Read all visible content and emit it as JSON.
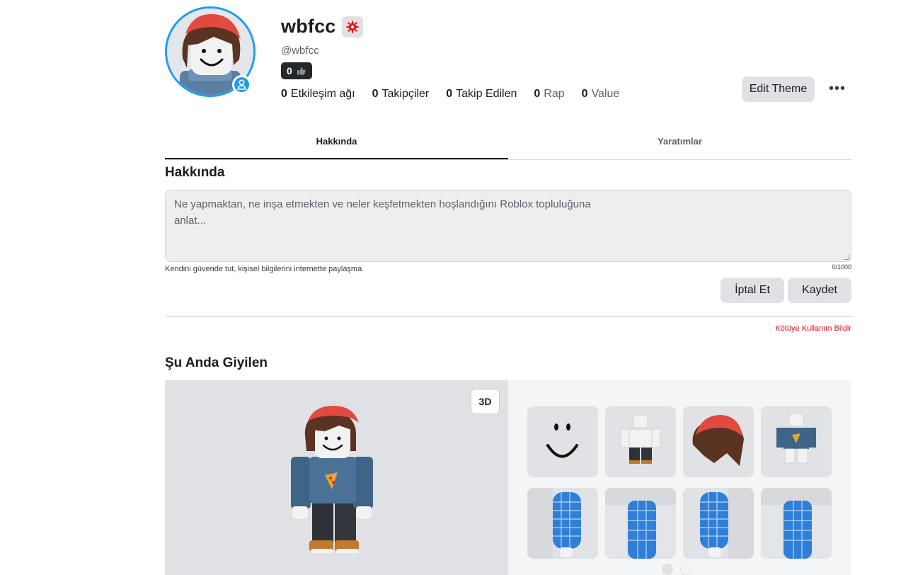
{
  "profile": {
    "display_name": "wbfcc",
    "username": "@wbfcc",
    "reputation": "0",
    "stats": [
      {
        "value": "0",
        "label": "Etkileşim ağı"
      },
      {
        "value": "0",
        "label": "Takipçiler"
      },
      {
        "value": "0",
        "label": "Takip Edilen"
      },
      {
        "value": "0",
        "label": "Rap"
      },
      {
        "value": "0",
        "label": "Value"
      }
    ],
    "edit_theme_label": "Edit Theme",
    "more_label": "•••"
  },
  "tabs": [
    {
      "label": "Hakkında",
      "active": true
    },
    {
      "label": "Yaratımlar",
      "active": false
    }
  ],
  "about": {
    "title": "Hakkında",
    "placeholder": "Ne yapmaktan, ne inşa etmekten ve neler keşfetmekten hoşlandığını Roblox topluluğuna anlat...",
    "safety_note": "Kendini güvende tut, kişisel bilgilerini internette paylaşma.",
    "char_count": "0/1000",
    "cancel_label": "İptal Et",
    "save_label": "Kaydet",
    "report_label": "Kötüye Kullanım Bildir"
  },
  "wearing": {
    "title": "Şu Anda Giyilen",
    "toggle_3d_label": "3D",
    "items": [
      {
        "icon": "face-smile-icon"
      },
      {
        "icon": "pants-outfit-icon"
      },
      {
        "icon": "red-beanie-hair-icon"
      },
      {
        "icon": "pizza-sweater-icon"
      },
      {
        "icon": "left-arm-icon"
      },
      {
        "icon": "left-leg-icon"
      },
      {
        "icon": "right-arm-icon"
      },
      {
        "icon": "right-leg-icon"
      }
    ]
  },
  "colors": {
    "accent": "#1e9cf0",
    "report_red": "#d8161c",
    "hat_red": "#e14b3f"
  }
}
